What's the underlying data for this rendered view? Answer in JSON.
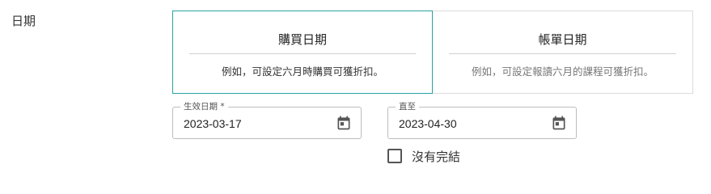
{
  "section": {
    "label": "日期"
  },
  "options": [
    {
      "title": "購買日期",
      "description": "例如，可設定六月時購買可獲折扣。",
      "selected": true
    },
    {
      "title": "帳單日期",
      "description": "例如，可設定報讀六月的課程可獲折扣。",
      "selected": false
    }
  ],
  "start_date": {
    "legend": "生效日期 *",
    "value": "2023-03-17",
    "icon": "calendar-icon"
  },
  "end_date": {
    "legend": "直至",
    "value": "2023-04-30",
    "icon": "calendar-icon"
  },
  "no_end": {
    "label": "沒有完結",
    "checked": false
  },
  "colors": {
    "accent": "#2aa3a1",
    "border": "#dcdcdc",
    "text": "#222222",
    "muted": "#777777"
  }
}
